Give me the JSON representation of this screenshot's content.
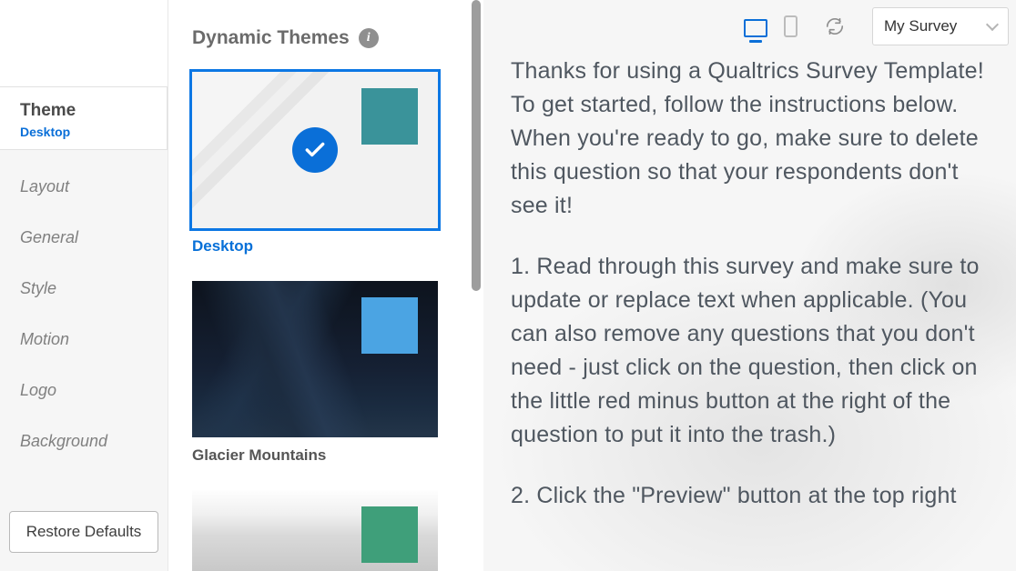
{
  "sidebar": {
    "active": {
      "title": "Theme",
      "subtitle": "Desktop"
    },
    "items": [
      "Layout",
      "General",
      "Style",
      "Motion",
      "Logo",
      "Background"
    ],
    "restore_label": "Restore Defaults"
  },
  "themes": {
    "header": "Dynamic Themes",
    "cards": [
      {
        "label": "Desktop",
        "swatch": "#3a939a",
        "selected": true
      },
      {
        "label": "Glacier Mountains",
        "swatch": "#4ba4e3",
        "selected": false
      },
      {
        "label": "",
        "swatch": "#3f9f7a",
        "selected": false
      }
    ]
  },
  "preview": {
    "survey_selector": "My Survey",
    "paragraphs": [
      "Thanks for using a Qualtrics Survey Template! To get started, follow the instructions below. When you're ready to go, make sure to delete this question so that your respondents don't see it!",
      "1. Read through this survey and make sure to update or replace text when applicable. (You can also remove any questions that you don't need - just click on the question, then click on the little red minus button at the right of the question to put it into the trash.)",
      "2. Click the \"Preview\" button at the top right"
    ]
  }
}
